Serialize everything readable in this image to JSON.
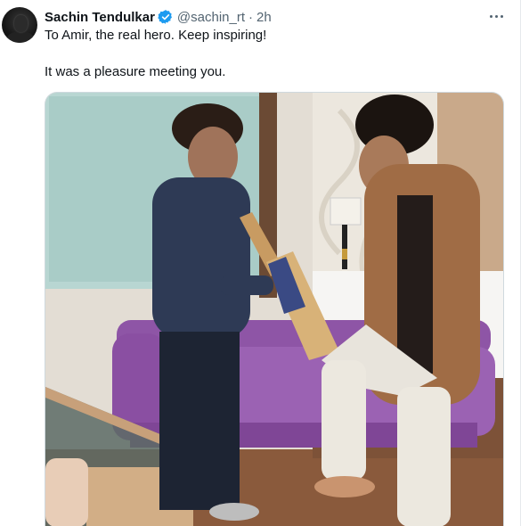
{
  "author": {
    "display_name": "Sachin Tendulkar",
    "handle": "@sachin_rt",
    "separator": "·",
    "timestamp": "2h",
    "verified": true,
    "avatar_icon": "avatar-photo"
  },
  "tweet": {
    "line1": "To Amir, the real hero. Keep inspiring!",
    "line2": "It was a pleasure meeting you."
  },
  "icons": {
    "more": "more-options-icon",
    "verified": "verified-badge-icon"
  },
  "colors": {
    "text_primary": "#0f1419",
    "text_secondary": "#536471",
    "verified_blue": "#1d9bf0",
    "sofa_purple": "#9b62b3"
  }
}
